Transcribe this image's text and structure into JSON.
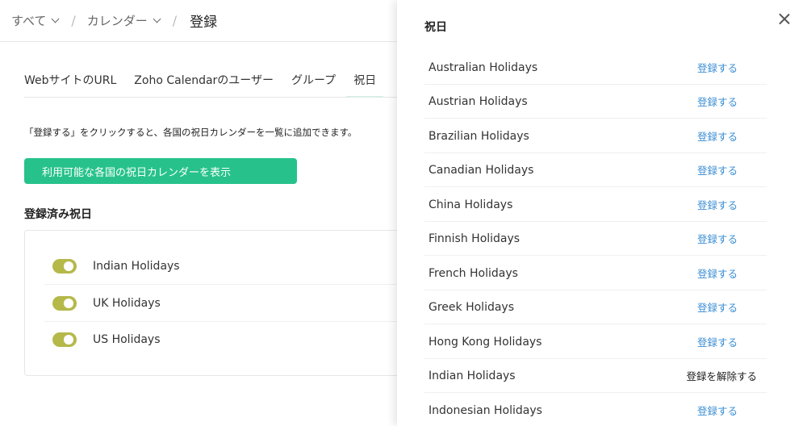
{
  "breadcrumb": {
    "all": "すべて",
    "calendar": "カレンダー",
    "separator": "/",
    "current": "登録"
  },
  "tabs": [
    {
      "label": "WebサイトのURL"
    },
    {
      "label": "Zoho Calendarのユーザー"
    },
    {
      "label": "グループ"
    },
    {
      "label": "祝日"
    }
  ],
  "description": "「登録する」をクリックすると、各国の祝日カレンダーを一覧に追加できます。",
  "show_button": "利用可能な各国の祝日カレンダーを表示",
  "subscribed_title": "登録済み祝日",
  "subscribed": [
    {
      "name": "Indian Holidays",
      "enabled": true
    },
    {
      "name": "UK Holidays",
      "enabled": true
    },
    {
      "name": "US Holidays",
      "enabled": true
    }
  ],
  "colors": {
    "accent": "#27c28c",
    "toggle": "#b5b94a",
    "link": "#3b8ed3"
  },
  "drawer": {
    "title": "祝日",
    "items": [
      {
        "name": "Australian Holidays",
        "action": "登録する"
      },
      {
        "name": "Austrian Holidays",
        "action": "登録する"
      },
      {
        "name": "Brazilian Holidays",
        "action": "登録する"
      },
      {
        "name": "Canadian Holidays",
        "action": "登録する"
      },
      {
        "name": "China Holidays",
        "action": "登録する"
      },
      {
        "name": "Finnish Holidays",
        "action": "登録する"
      },
      {
        "name": "French Holidays",
        "action": "登録する"
      },
      {
        "name": "Greek Holidays",
        "action": "登録する"
      },
      {
        "name": "Hong Kong Holidays",
        "action": "登録する"
      },
      {
        "name": "Indian Holidays",
        "action": "登録を解除する"
      },
      {
        "name": "Indonesian Holidays",
        "action": "登録する"
      }
    ]
  }
}
